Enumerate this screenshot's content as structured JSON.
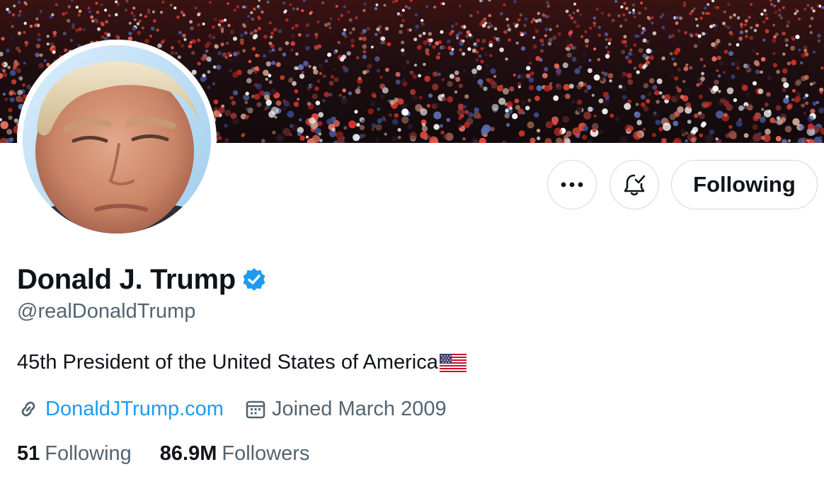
{
  "profile": {
    "display_name": "Donald J. Trump",
    "handle": "@realDonaldTrump",
    "bio": "45th President of the United States of America",
    "website": "DonaldJTrump.com",
    "joined": "Joined March 2009",
    "following_count": "51",
    "following_label": "Following",
    "followers_count": "86.9M",
    "followers_label": "Followers",
    "verified": true
  },
  "actions": {
    "more_label": "···",
    "follow_button_label": "Following"
  },
  "icons": {
    "more": "more-dots-icon",
    "notifications": "bell-check-icon",
    "verified": "verified-badge-icon",
    "link": "link-icon",
    "calendar": "calendar-icon",
    "flag": "us-flag-emoji"
  },
  "colors": {
    "accent": "#1d9bf0",
    "text_primary": "#0f1419",
    "text_secondary": "#536471",
    "border": "#cfd9de"
  }
}
